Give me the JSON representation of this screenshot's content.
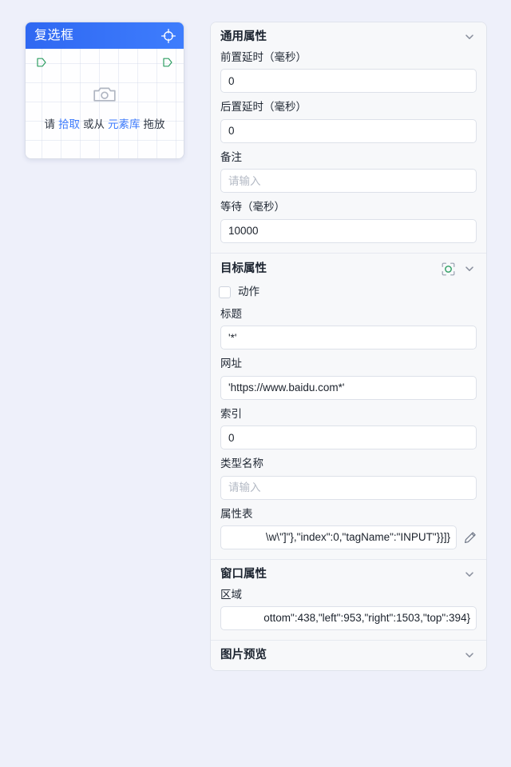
{
  "node_card": {
    "title": "复选框",
    "header_icon": "crosshair-target-icon",
    "port_icon": "flow-port-icon",
    "preview_icon": "camera-icon",
    "hint": {
      "part1": "请",
      "link1": "拾取",
      "part2": "或从",
      "link2": "元素库",
      "part3": "拖放"
    },
    "colors": {
      "header_start": "#2f68f2",
      "header_end": "#3e7dfd",
      "link": "#3d7bfc",
      "port": "#2e9e62"
    }
  },
  "panel": {
    "sections": [
      {
        "title": "通用属性",
        "chevron_icon": "chevron-down-icon",
        "fields": [
          {
            "label": "前置延时（毫秒）",
            "value": "0",
            "placeholder": "请输入"
          },
          {
            "label": "后置延时（毫秒）",
            "value": "0",
            "placeholder": "请输入"
          },
          {
            "label": "备注",
            "value": "",
            "placeholder": "请输入"
          },
          {
            "label": "等待（毫秒）",
            "value": "10000",
            "placeholder": "请输入"
          }
        ]
      },
      {
        "title": "目标属性",
        "chevron_icon": "chevron-down-icon",
        "picker_icon": "element-picker-icon",
        "checkbox": {
          "label": "动作",
          "checked": false
        },
        "fields": [
          {
            "label": "标题",
            "value": "'*'",
            "placeholder": "请输入"
          },
          {
            "label": "网址",
            "value": "'https://www.baidu.com*'",
            "placeholder": "请输入"
          },
          {
            "label": "索引",
            "value": "0",
            "placeholder": "请输入"
          },
          {
            "label": "类型名称",
            "value": "",
            "placeholder": "请输入"
          },
          {
            "label": "属性表",
            "value": "\\w\\\"]\"},\"index\":0,\"tagName\":\"INPUT\"}}]}",
            "placeholder": "请输入",
            "edit_icon": "pencil-edit-icon"
          }
        ]
      },
      {
        "title": "窗口属性",
        "chevron_icon": "chevron-down-icon",
        "fields": [
          {
            "label": "区域",
            "value": "ottom\":438,\"left\":953,\"right\":1503,\"top\":394}",
            "placeholder": "请输入"
          }
        ]
      },
      {
        "title": "图片预览",
        "chevron_icon": "chevron-down-icon",
        "fields": []
      }
    ]
  }
}
